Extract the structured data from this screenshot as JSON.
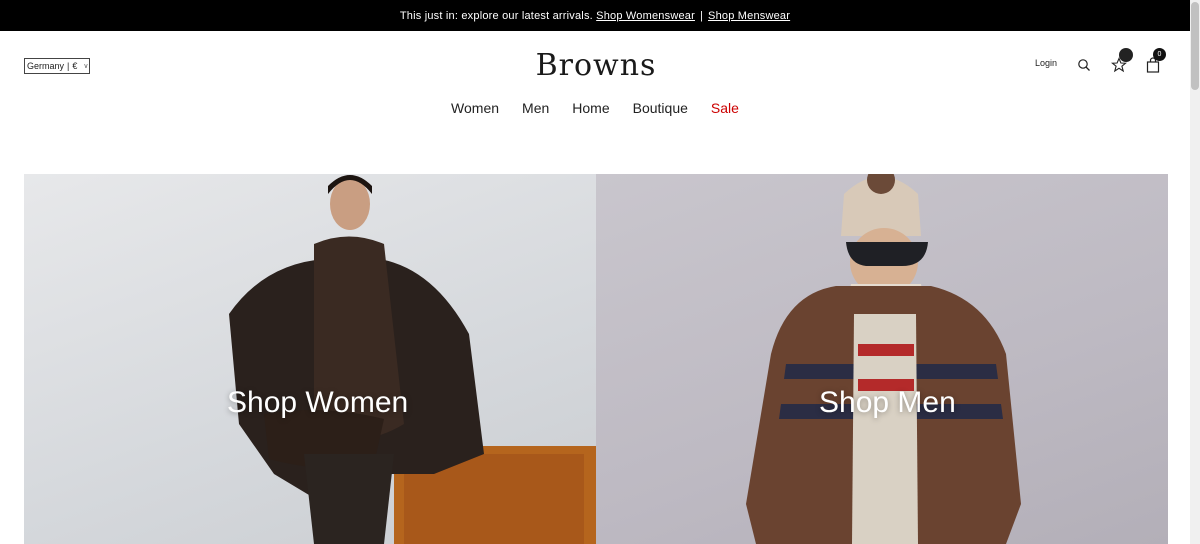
{
  "promo": {
    "text": "This just in: explore our latest arrivals.",
    "link_women": "Shop Womenswear",
    "separator": "|",
    "link_men": "Shop Menswear"
  },
  "region": {
    "country": "Germany",
    "divider": "|",
    "currency": "€"
  },
  "brand": {
    "logo_text": "Browns"
  },
  "header": {
    "login_label": "Login",
    "bag_count": "0"
  },
  "nav": {
    "women": "Women",
    "men": "Men",
    "home": "Home",
    "boutique": "Boutique",
    "sale": "Sale"
  },
  "hero": {
    "women_label": "Shop Women",
    "men_label": "Shop Men"
  },
  "colors": {
    "sale": "#cc0000",
    "promo_bg": "#000000"
  }
}
